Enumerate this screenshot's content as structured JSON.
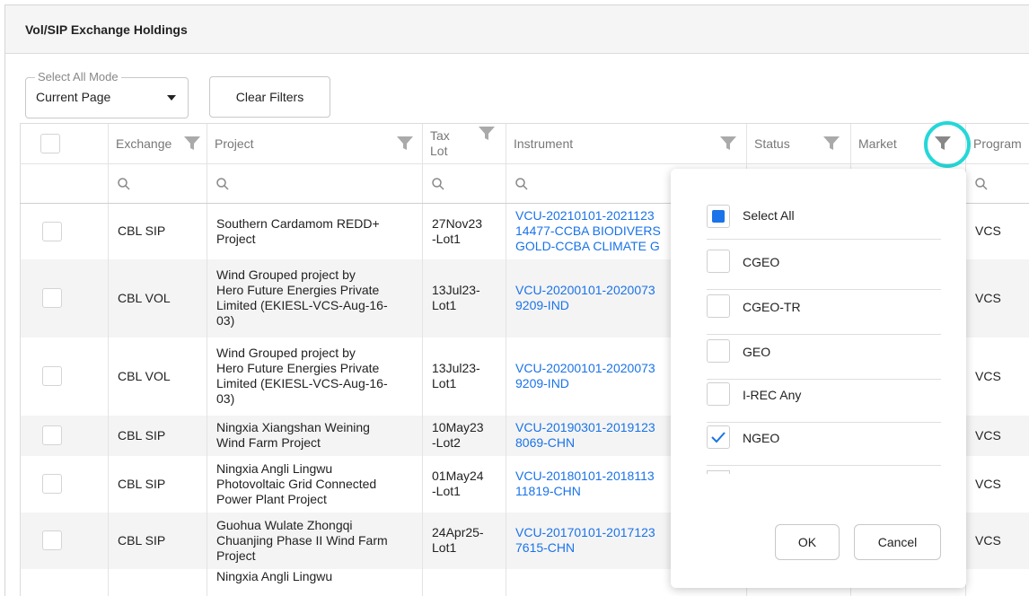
{
  "panel": {
    "title": "Vol/SIP Exchange Holdings"
  },
  "toolbar": {
    "select_mode_label": "Select All Mode",
    "select_mode_value": "Current Page",
    "clear_filters": "Clear Filters"
  },
  "columns": {
    "exchange": "Exchange",
    "project": "Project",
    "tax_lot_1": "Tax",
    "tax_lot_2": "Lot",
    "instrument": "Instrument",
    "status": "Status",
    "market": "Market",
    "program": "Program"
  },
  "rows": [
    {
      "exchange": "CBL SIP",
      "project": [
        "Southern Cardamom REDD+",
        "Project"
      ],
      "lot": [
        "27Nov23",
        "-Lot1"
      ],
      "instrument": [
        "VCU-20210101-2021123",
        "14477-CCBA BIODIVERS",
        "GOLD-CCBA CLIMATE G"
      ],
      "program": "VCS"
    },
    {
      "exchange": "CBL VOL",
      "project": [
        "Wind Grouped project by",
        "Hero Future Energies Private",
        "Limited (EKIESL-VCS-Aug-16-",
        "03)"
      ],
      "lot": [
        "13Jul23-",
        "Lot1"
      ],
      "instrument": [
        "VCU-20200101-2020073",
        "9209-IND"
      ],
      "program": "VCS"
    },
    {
      "exchange": "CBL VOL",
      "project": [
        "Wind Grouped project by",
        "Hero Future Energies Private",
        "Limited (EKIESL-VCS-Aug-16-",
        "03)"
      ],
      "lot": [
        "13Jul23-",
        "Lot1"
      ],
      "instrument": [
        "VCU-20200101-2020073",
        "9209-IND"
      ],
      "program": "VCS"
    },
    {
      "exchange": "CBL SIP",
      "project": [
        "Ningxia Xiangshan Weining",
        "Wind Farm Project"
      ],
      "lot": [
        "10May23",
        "-Lot2"
      ],
      "instrument": [
        "VCU-20190301-2019123",
        "8069-CHN"
      ],
      "program": "VCS"
    },
    {
      "exchange": "CBL SIP",
      "project": [
        "Ningxia Angli Lingwu",
        "Photovoltaic Grid Connected",
        "Power Plant Project"
      ],
      "lot": [
        "01May24",
        "-Lot1"
      ],
      "instrument": [
        "VCU-20180101-2018113",
        "11819-CHN"
      ],
      "program": "VCS"
    },
    {
      "exchange": "CBL SIP",
      "project": [
        "Guohua Wulate Zhongqi",
        "Chuanjing Phase II Wind Farm",
        "Project"
      ],
      "lot": [
        "24Apr25-",
        "Lot1"
      ],
      "instrument": [
        "VCU-20170101-2017123",
        "7615-CHN"
      ],
      "program": "VCS"
    },
    {
      "exchange": "",
      "project": [
        "Ningxia Angli Lingwu"
      ],
      "lot": [],
      "instrument": [],
      "program": ""
    }
  ],
  "market_filter": {
    "options": [
      {
        "label": "Select All",
        "state": "indeterminate"
      },
      {
        "label": "CGEO",
        "state": "unchecked"
      },
      {
        "label": "CGEO-TR",
        "state": "unchecked"
      },
      {
        "label": "GEO",
        "state": "unchecked"
      },
      {
        "label": "I-REC Any",
        "state": "unchecked"
      },
      {
        "label": "NGEO",
        "state": "checked"
      }
    ],
    "ok": "OK",
    "cancel": "Cancel"
  },
  "colors": {
    "link": "#1a73e8",
    "accent": "#1a73e8",
    "highlight_ring": "#25d7d7"
  },
  "icons": [
    "funnel-icon",
    "search-icon",
    "caret-down-icon",
    "check-icon"
  ]
}
